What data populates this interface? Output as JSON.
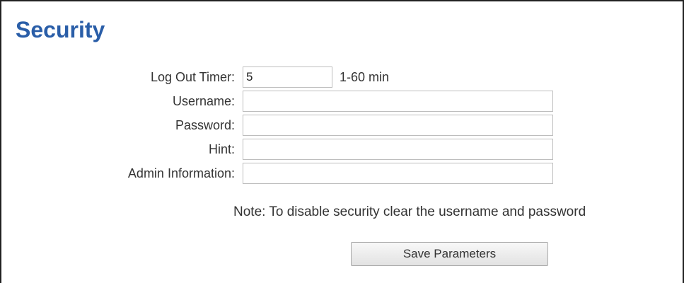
{
  "page": {
    "title": "Security"
  },
  "form": {
    "log_out_timer": {
      "label": "Log Out Timer:",
      "value": "5",
      "hint": "1-60 min"
    },
    "username": {
      "label": "Username:",
      "value": ""
    },
    "password": {
      "label": "Password:",
      "value": ""
    },
    "hint": {
      "label": "Hint:",
      "value": ""
    },
    "admin_information": {
      "label": "Admin Information:",
      "value": ""
    }
  },
  "note": "Note: To disable security clear the username and password",
  "actions": {
    "save_label": "Save Parameters"
  },
  "colors": {
    "title": "#2a5ea8",
    "border": "#222222",
    "field_border": "#bdbdbd"
  }
}
